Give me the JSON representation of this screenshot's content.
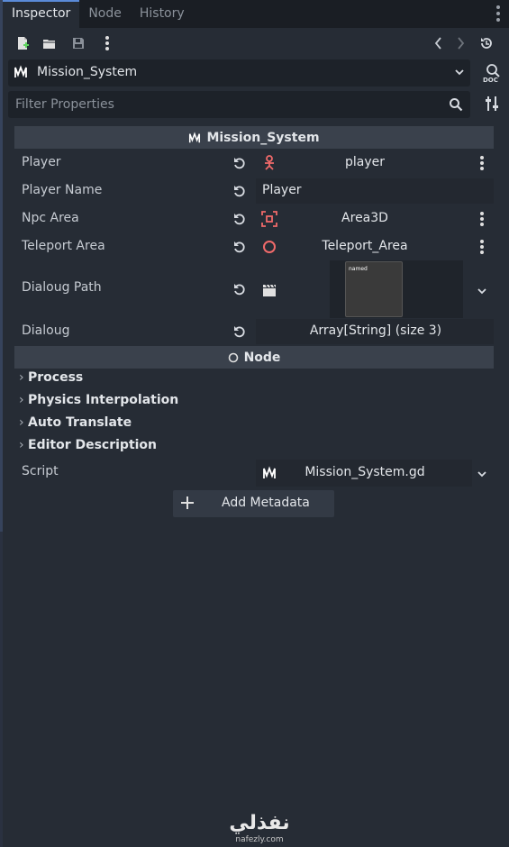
{
  "tabs": [
    "Inspector",
    "Node",
    "History"
  ],
  "object_selector": {
    "name": "Mission_System"
  },
  "filter": {
    "placeholder": "Filter Properties"
  },
  "sections": {
    "script_section": "Mission_System",
    "node_section": "Node"
  },
  "properties": [
    {
      "label": "Player",
      "value": "player"
    },
    {
      "label": "Player Name",
      "value": "Player"
    },
    {
      "label": "Npc Area",
      "value": "Area3D"
    },
    {
      "label": "Teleport Area",
      "value": "Teleport_Area"
    },
    {
      "label": "Dialoug Path",
      "thumbnail_text": "named"
    },
    {
      "label": "Dialoug",
      "value": "Array[String] (size 3)"
    }
  ],
  "groups": [
    "Process",
    "Physics Interpolation",
    "Auto Translate",
    "Editor Description"
  ],
  "script": {
    "label": "Script",
    "value": "Mission_System.gd"
  },
  "add_metadata": "Add Metadata",
  "watermark": {
    "arabic": "نفذلي",
    "latin": "nafezly.com"
  },
  "colors": {
    "accent": "#5a8ad8",
    "node_icon_red": "#f06a6a",
    "script_icon": "#ffffff"
  },
  "icons": [
    "new-script-icon",
    "open-icon",
    "save-icon",
    "history-back-icon",
    "history-forward-icon",
    "object-history-icon",
    "doc-icon",
    "search-icon",
    "tools-icon",
    "revert-icon",
    "character-icon",
    "area-icon",
    "node-icon",
    "clapper-icon",
    "plus-icon"
  ]
}
